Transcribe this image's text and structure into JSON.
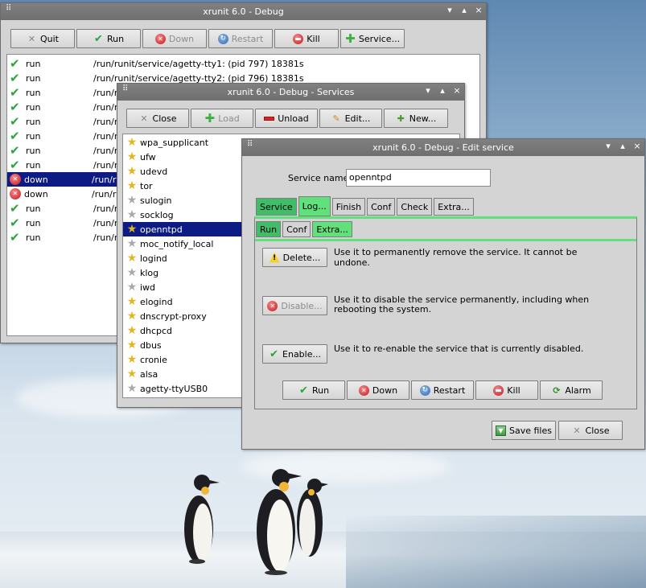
{
  "main_window": {
    "title": "xrunit 6.0 - Debug",
    "buttons": [
      "Quit",
      "Run",
      "Down",
      "Restart",
      "Kill",
      "Service..."
    ],
    "rows": [
      {
        "status": "run",
        "text": "/run/runit/service/agetty-tty1: (pid 797) 18381s"
      },
      {
        "status": "run",
        "text": "/run/runit/service/agetty-tty2: (pid 796) 18381s"
      },
      {
        "status": "run",
        "text": "/run/ru"
      },
      {
        "status": "run",
        "text": "/run/ru"
      },
      {
        "status": "run",
        "text": "/run/ru"
      },
      {
        "status": "run",
        "text": "/run/ru"
      },
      {
        "status": "run",
        "text": "/run/ru"
      },
      {
        "status": "run",
        "text": "/run/ru"
      },
      {
        "status": "down",
        "text": "/run/ru"
      },
      {
        "status": "down",
        "text": "/run/ru"
      },
      {
        "status": "run",
        "text": "/run/ru"
      },
      {
        "status": "run",
        "text": "/run/ru"
      },
      {
        "status": "run",
        "text": "/run/ru"
      }
    ]
  },
  "services_window": {
    "title": "xrunit 6.0 - Debug - Services",
    "buttons": [
      "Close",
      "Load",
      "Unload",
      "Edit...",
      "New..."
    ],
    "items": [
      "wpa_supplicant",
      "ufw",
      "udevd",
      "tor",
      "sulogin",
      "socklog",
      "openntpd",
      "moc_notify_local",
      "logind",
      "klog",
      "iwd",
      "elogind",
      "dnscrypt-proxy",
      "dhcpcd",
      "dbus",
      "cronie",
      "alsa",
      "agetty-ttyUSB0"
    ]
  },
  "edit_window": {
    "title": "xrunit 6.0 - Debug - Edit service",
    "service_name_label": "Service name:",
    "service_name_value": "openntpd",
    "tabs": [
      "Service",
      "Log...",
      "Finish",
      "Conf",
      "Check",
      "Extra..."
    ],
    "subtabs": [
      "Run",
      "Conf",
      "Extra..."
    ],
    "actions": [
      {
        "label": "Delete...",
        "desc": "Use it to permanently remove the service. It cannot be undone."
      },
      {
        "label": "Disable...",
        "desc": "Use it to disable the service permanently, including when rebooting the system."
      },
      {
        "label": "Enable...",
        "desc": "Use it to re-enable the service that is currently disabled."
      }
    ],
    "control_buttons": [
      "Run",
      "Down",
      "Restart",
      "Kill",
      "Alarm"
    ],
    "footer_buttons": [
      "Save files",
      "Close"
    ]
  }
}
